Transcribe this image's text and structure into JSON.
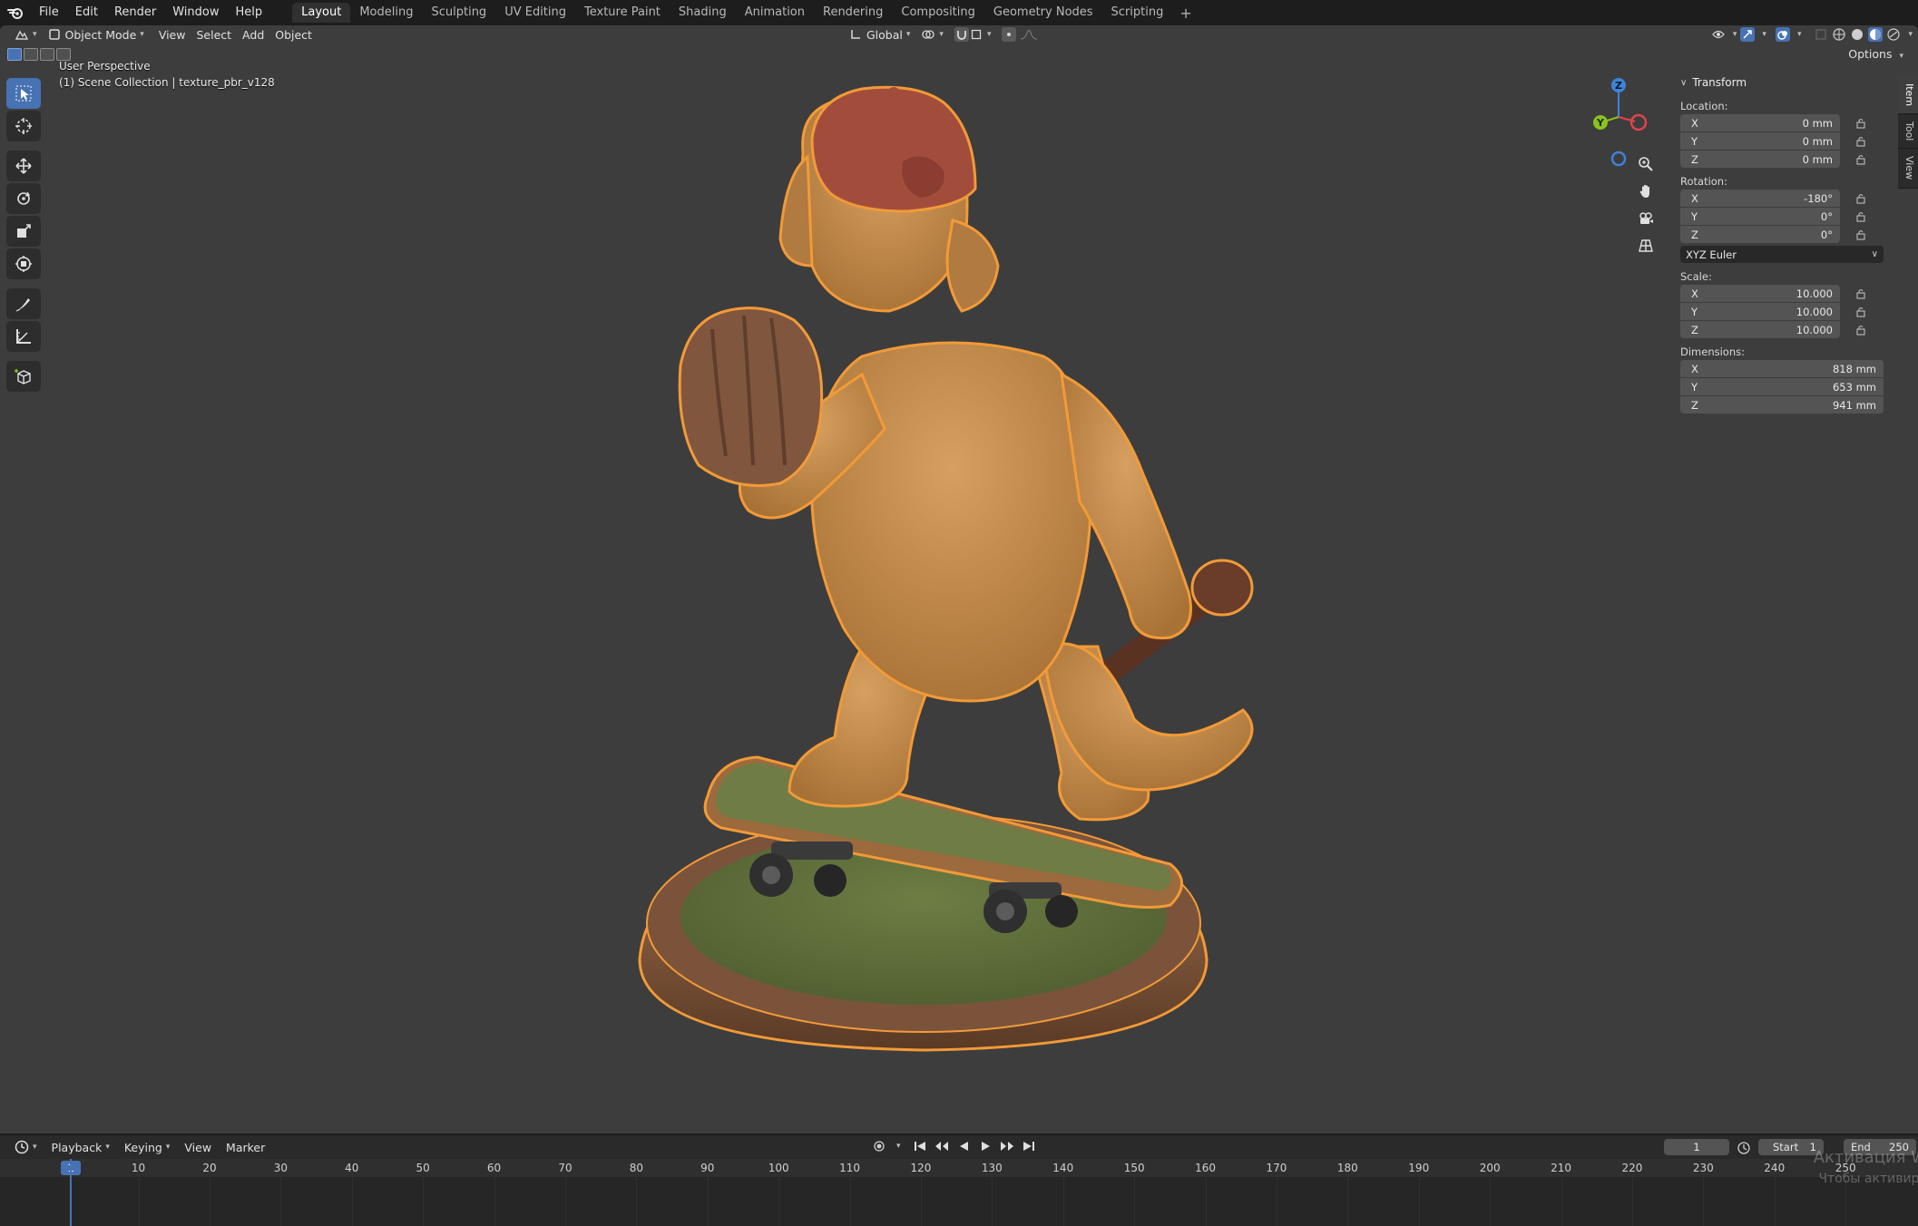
{
  "menu": {
    "items": [
      "File",
      "Edit",
      "Render",
      "Window",
      "Help"
    ]
  },
  "workspaces": {
    "tabs": [
      "Layout",
      "Modeling",
      "Sculpting",
      "UV Editing",
      "Texture Paint",
      "Shading",
      "Animation",
      "Rendering",
      "Compositing",
      "Geometry Nodes",
      "Scripting"
    ],
    "add_label": "+"
  },
  "viewport_header": {
    "mode": "Object Mode",
    "menus": [
      "View",
      "Select",
      "Add",
      "Object"
    ],
    "transform_orientation": "Global",
    "options_label": "Options"
  },
  "overlay": {
    "view_name": "User Perspective",
    "collection": "(1) Scene Collection | texture_pbr_v128"
  },
  "toolbar": {
    "tools": [
      "select-box",
      "cursor",
      "move",
      "rotate",
      "scale",
      "transform",
      "annotate",
      "measure",
      "add-cube"
    ],
    "active": "select-box"
  },
  "gizmo": {
    "z": "Z",
    "y": "Y",
    "colors": {
      "x": "#e2434d",
      "y": "#8bc21f",
      "z": "#3f83d9"
    }
  },
  "side_tabs": [
    "Item",
    "Tool",
    "View"
  ],
  "transform": {
    "title": "Transform",
    "location_label": "Location:",
    "location": [
      {
        "axis": "X",
        "value": "0 mm"
      },
      {
        "axis": "Y",
        "value": "0 mm"
      },
      {
        "axis": "Z",
        "value": "0 mm"
      }
    ],
    "rotation_label": "Rotation:",
    "rotation": [
      {
        "axis": "X",
        "value": "-180°"
      },
      {
        "axis": "Y",
        "value": "0°"
      },
      {
        "axis": "Z",
        "value": "0°"
      }
    ],
    "rotation_mode": "XYZ Euler",
    "scale_label": "Scale:",
    "scale": [
      {
        "axis": "X",
        "value": "10.000"
      },
      {
        "axis": "Y",
        "value": "10.000"
      },
      {
        "axis": "Z",
        "value": "10.000"
      }
    ],
    "dimensions_label": "Dimensions:",
    "dimensions": [
      {
        "axis": "X",
        "value": "818 mm"
      },
      {
        "axis": "Y",
        "value": "653 mm"
      },
      {
        "axis": "Z",
        "value": "941 mm"
      }
    ]
  },
  "timeline": {
    "menus": [
      "Playback",
      "Keying",
      "View",
      "Marker"
    ],
    "current_frame": "1",
    "start_label": "Start",
    "start_value": "1",
    "end_label": "End",
    "end_value": "250",
    "ruler_labels": [
      "1",
      "10",
      "20",
      "30",
      "40",
      "50",
      "60",
      "70",
      "80",
      "90",
      "100",
      "110",
      "120",
      "130",
      "140",
      "150",
      "160",
      "170",
      "180",
      "190",
      "200",
      "210",
      "220",
      "230",
      "240",
      "250"
    ]
  },
  "watermark": {
    "line1": "Активация W",
    "line2": "Чтобы активиро"
  },
  "colors": {
    "accent": "#4772b3",
    "selection_outline": "#f29a38",
    "viewport_bg": "#3d3d3d"
  }
}
